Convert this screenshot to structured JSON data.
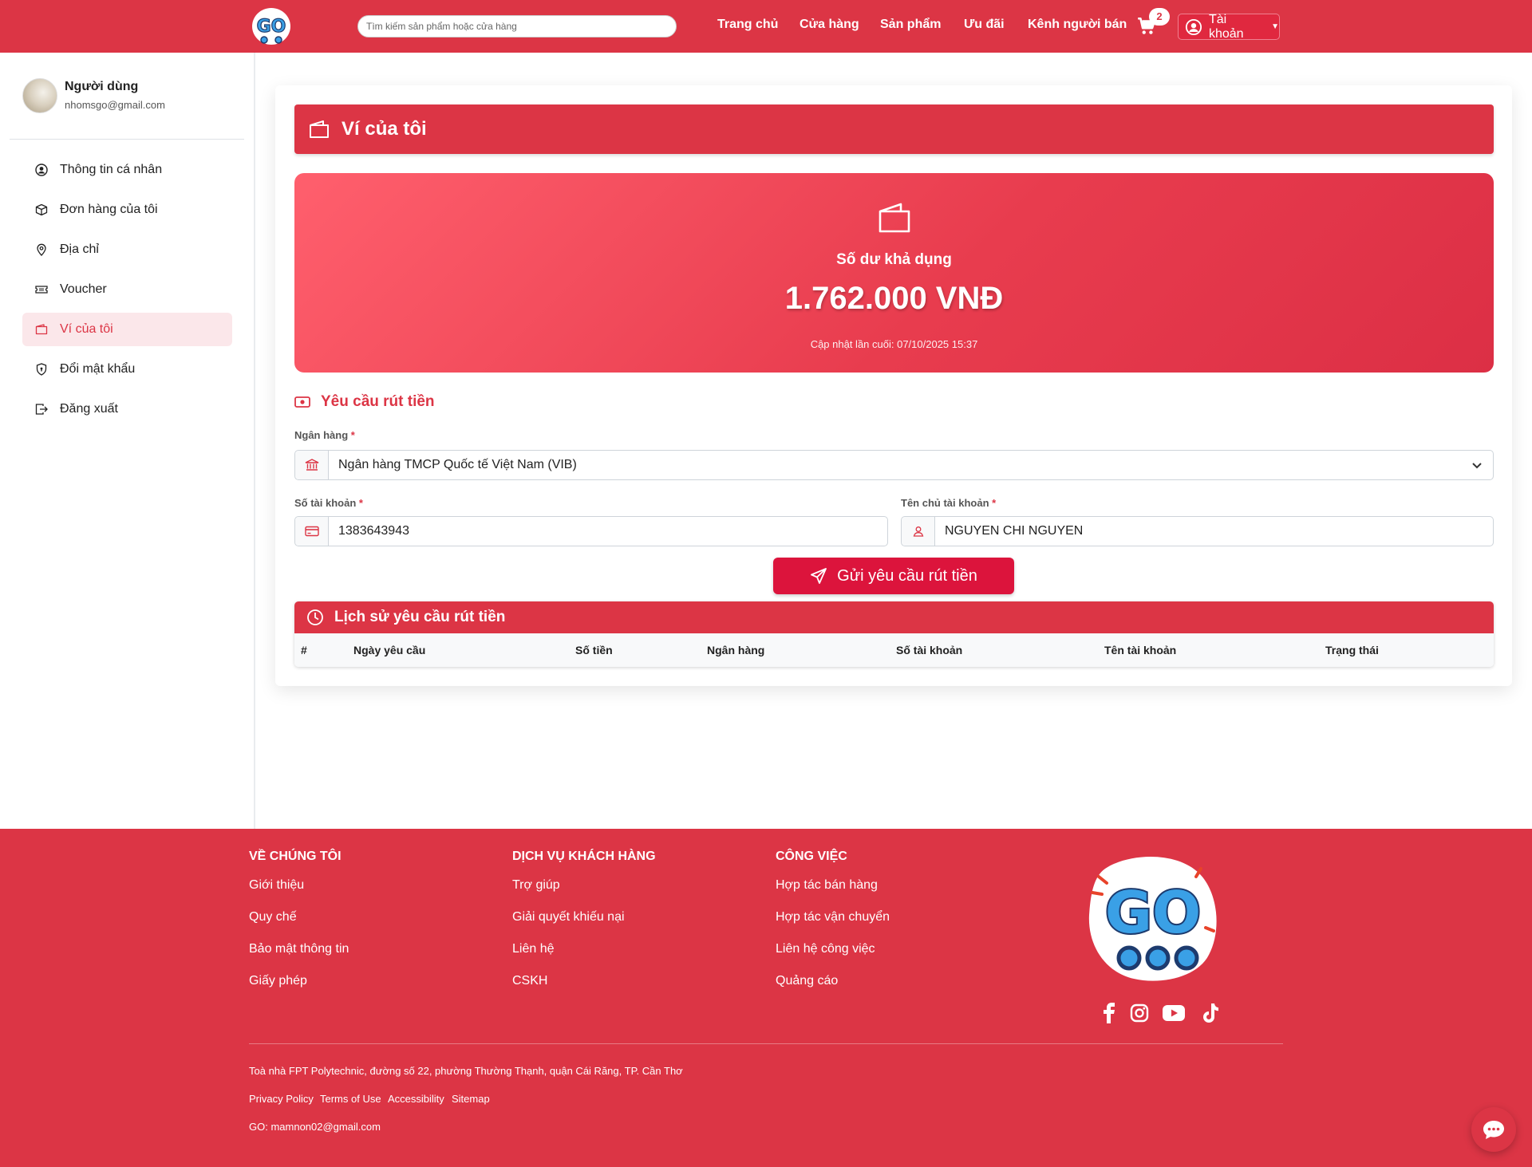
{
  "colors": {
    "brand": "#dc3545",
    "accent": "#dc143c",
    "active_bg": "#fbe7ea"
  },
  "header": {
    "logo_text": "GO",
    "search_placeholder": "Tìm kiếm sản phẩm hoặc cửa hàng",
    "nav": [
      "Trang chủ",
      "Cửa hàng",
      "Sản phẩm",
      "Ưu đãi",
      "Kênh người bán"
    ],
    "cart_count": "2",
    "account_label": "Tài khoản"
  },
  "sidebar": {
    "user_name": "Người dùng",
    "user_email": "nhomsgo@gmail.com",
    "items": [
      {
        "label": "Thông tin cá nhân",
        "icon": "user-circle-icon"
      },
      {
        "label": "Đơn hàng của tôi",
        "icon": "box-icon"
      },
      {
        "label": "Địa chỉ",
        "icon": "location-pin-icon"
      },
      {
        "label": "Voucher",
        "icon": "ticket-icon"
      },
      {
        "label": "Ví của tôi",
        "icon": "wallet-icon",
        "active": true
      },
      {
        "label": "Đổi mật khẩu",
        "icon": "shield-lock-icon"
      },
      {
        "label": "Đăng xuất",
        "icon": "logout-icon"
      }
    ]
  },
  "wallet": {
    "title": "Ví của tôi",
    "balance_label": "Số dư khả dụng",
    "balance_amount": "1.762.000 VNĐ",
    "last_updated": "Cập nhật lần cuối: 07/10/2025 15:37"
  },
  "withdraw": {
    "section_title": "Yêu cầu rút tiền",
    "bank_label": "Ngân hàng",
    "bank_value": "Ngân hàng TMCP Quốc tế Việt Nam (VIB)",
    "account_number_label": "Số tài khoản",
    "account_number_value": "1383643943",
    "account_holder_label": "Tên chủ tài khoản",
    "account_holder_value": "NGUYEN CHI NGUYEN",
    "required_mark": "*",
    "submit_label": "Gửi yêu cầu rút tiền"
  },
  "history": {
    "title": "Lịch sử yêu cầu rút tiền",
    "columns": [
      "#",
      "Ngày yêu cầu",
      "Số tiền",
      "Ngân hàng",
      "Số tài khoản",
      "Tên tài khoản",
      "Trạng thái"
    ]
  },
  "footer": {
    "columns": [
      {
        "title": "VỀ CHÚNG TÔI",
        "links": [
          "Giới thiệu",
          "Quy chế",
          "Bảo mật thông tin",
          "Giấy phép"
        ]
      },
      {
        "title": "DỊCH VỤ KHÁCH HÀNG",
        "links": [
          "Trợ giúp",
          "Giải quyết khiếu nại",
          "Liên hệ",
          "CSKH"
        ]
      },
      {
        "title": "CÔNG VIỆC",
        "links": [
          "Hợp tác bán hàng",
          "Hợp tác vận chuyển",
          "Liên hệ công việc",
          "Quảng cáo"
        ]
      }
    ],
    "address": "Toà nhà FPT Polytechnic, đường số 22, phường Thường Thạnh, quận Cái Răng, TP. Cần Thơ",
    "bottom_links": [
      "Privacy Policy",
      "Terms of Use",
      "Accessibility",
      "Sitemap"
    ],
    "contact": "GO: mamnon02@gmail.com",
    "social": [
      "facebook-icon",
      "instagram-icon",
      "youtube-icon",
      "tiktok-icon"
    ]
  }
}
